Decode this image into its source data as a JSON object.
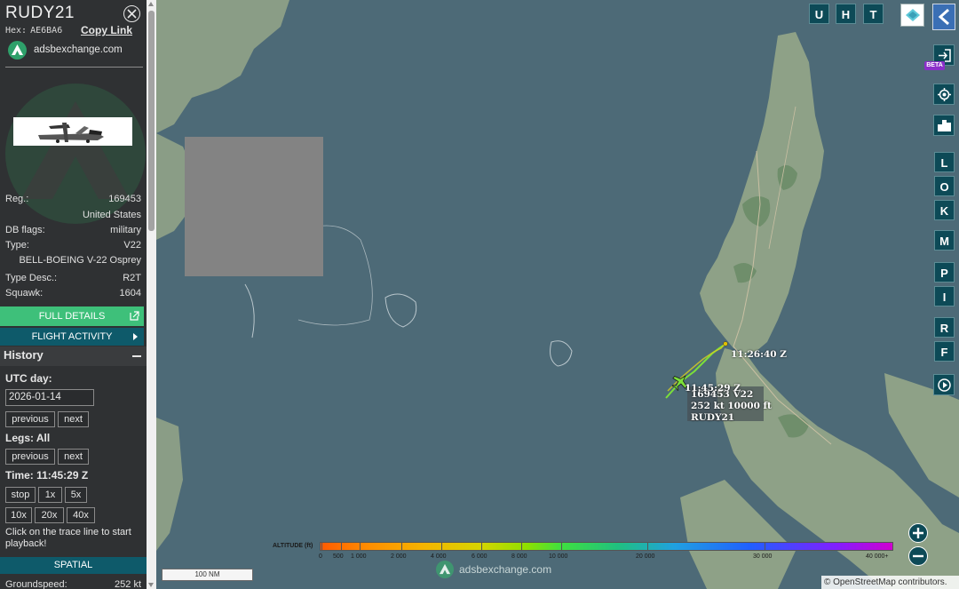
{
  "aircraft": {
    "callsign": "RUDY21",
    "hex_label": "Hex:",
    "hex": "AE6BA6",
    "copy_link": "Copy Link",
    "source": "adsbexchange.com"
  },
  "info": [
    {
      "label": "Reg.:",
      "value": "169453"
    },
    {
      "label": "",
      "value": "United States"
    },
    {
      "label": "DB flags:",
      "value": "military"
    },
    {
      "label": "Type:",
      "value": "V22"
    },
    {
      "label": "",
      "value": "BELL-BOEING V-22 Osprey"
    },
    {
      "label": "Type Desc.:",
      "value": "R2T"
    },
    {
      "label": "Squawk:",
      "value": "1604"
    }
  ],
  "buttons": {
    "full_details": "FULL DETAILS",
    "flight_activity": "FLIGHT ACTIVITY",
    "spatial": "SPATIAL"
  },
  "history": {
    "title": "History",
    "utc_day_label": "UTC day:",
    "date": "2026-01-14",
    "previous": "previous",
    "next": "next",
    "legs_label": "Legs: All",
    "time_label": "Time: 11:45:29 Z",
    "speeds": [
      "stop",
      "1x",
      "5x",
      "10x",
      "20x",
      "40x"
    ],
    "hint": "Click on the trace line to start playback!"
  },
  "spatial_row": {
    "label": "Groundspeed:",
    "value": "252 kt"
  },
  "map": {
    "top_buttons": [
      "U",
      "H",
      "T"
    ],
    "side_buttons": [
      "L",
      "O",
      "K",
      "M",
      "P",
      "I",
      "R",
      "F"
    ],
    "beta": "BETA",
    "altitude_label": "ALTITUDE (ft)",
    "altitude_ticks": [
      "0",
      "500",
      "1 000",
      "2 000",
      "4 000",
      "6 000",
      "8 000",
      "10 000",
      "20 000",
      "30 000",
      "40 000+"
    ],
    "scale": "100 NM",
    "credit_prefix": "©",
    "credit_link": "OpenStreetMap",
    "credit_suffix": "contributors.",
    "watermark": "adsbexchange.com",
    "tag": {
      "line1": "169453 V22",
      "line2": "252 kt  10000 ft",
      "line3": "RUDY21"
    },
    "time_start": "11:26:40 Z",
    "time_end": "11:45:29 Z"
  },
  "colors": {
    "sidebar_bg": "#2f3133",
    "full_details_bg": "#3ec07a",
    "section_bg": "#0e5a6a",
    "map_water": "#4d6a77",
    "map_land": "#8c9f86"
  }
}
